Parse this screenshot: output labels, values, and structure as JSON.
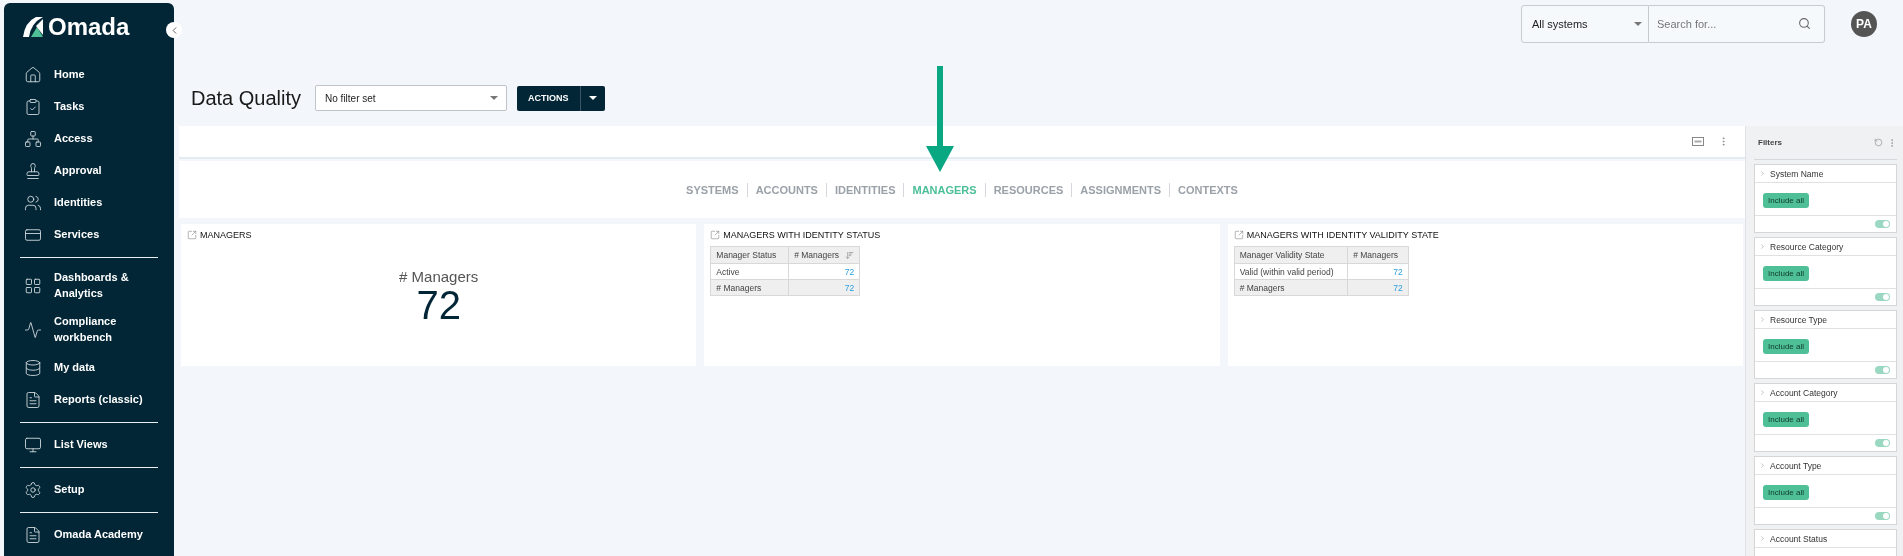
{
  "sidebar": {
    "logo": "Omada",
    "groups": [
      {
        "items": [
          {
            "label": "Home"
          },
          {
            "label": "Tasks"
          },
          {
            "label": "Access"
          },
          {
            "label": "Approval"
          },
          {
            "label": "Identities"
          },
          {
            "label": "Services"
          }
        ]
      },
      {
        "items": [
          {
            "label": "Dashboards & Analytics"
          },
          {
            "label": "Compliance workbench"
          },
          {
            "label": "My data"
          },
          {
            "label": "Reports (classic)"
          }
        ]
      },
      {
        "items": [
          {
            "label": "List Views"
          }
        ]
      },
      {
        "items": [
          {
            "label": "Setup"
          }
        ]
      },
      {
        "items": [
          {
            "label": "Omada Academy"
          }
        ]
      }
    ]
  },
  "topbar": {
    "system_select": "All systems",
    "search": {
      "placeholder": "Search for..."
    },
    "avatar": "PA"
  },
  "page": {
    "title": "Data Quality",
    "filter_select": "No filter set",
    "actions_button": "ACTIONS"
  },
  "tabs": [
    {
      "label": "SYSTEMS",
      "selected": false
    },
    {
      "label": "ACCOUNTS",
      "selected": false
    },
    {
      "label": "IDENTITIES",
      "selected": false
    },
    {
      "label": "MANAGERS",
      "selected": true
    },
    {
      "label": "RESOURCES",
      "selected": false
    },
    {
      "label": "ASSIGNMENTS",
      "selected": false
    },
    {
      "label": "CONTEXTS",
      "selected": false
    }
  ],
  "panels": [
    {
      "kind": "kpi",
      "title": "MANAGERS",
      "label": "# Managers",
      "value": "72"
    },
    {
      "kind": "table",
      "title": "MANAGERS WITH IDENTITY STATUS",
      "columns": [
        {
          "label": "Manager Status",
          "sorted": false
        },
        {
          "label": "# Managers",
          "sorted": true
        }
      ],
      "rows": [
        {
          "cells": [
            "Active",
            "72"
          ],
          "total": false
        },
        {
          "cells": [
            "# Managers",
            "72"
          ],
          "total": true
        }
      ]
    },
    {
      "kind": "table",
      "title": "MANAGERS WITH IDENTITY VALIDITY STATE",
      "columns": [
        {
          "label": "Manager Validity State",
          "sorted": false
        },
        {
          "label": "# Managers",
          "sorted": false
        }
      ],
      "rows": [
        {
          "cells": [
            "Valid (within valid period)",
            "72"
          ],
          "total": false
        },
        {
          "cells": [
            "# Managers",
            "72"
          ],
          "total": true
        }
      ]
    }
  ],
  "filters": {
    "title": "Filters",
    "items": [
      {
        "label": "System Name",
        "chip": "Include all",
        "on": true
      },
      {
        "label": "Resource Category",
        "chip": "Include all",
        "on": true
      },
      {
        "label": "Resource Type",
        "chip": "Include all",
        "on": true
      },
      {
        "label": "Account Category",
        "chip": "Include all",
        "on": true
      },
      {
        "label": "Account Type",
        "chip": "Include all",
        "on": true
      },
      {
        "label": "Account Status"
      }
    ]
  }
}
